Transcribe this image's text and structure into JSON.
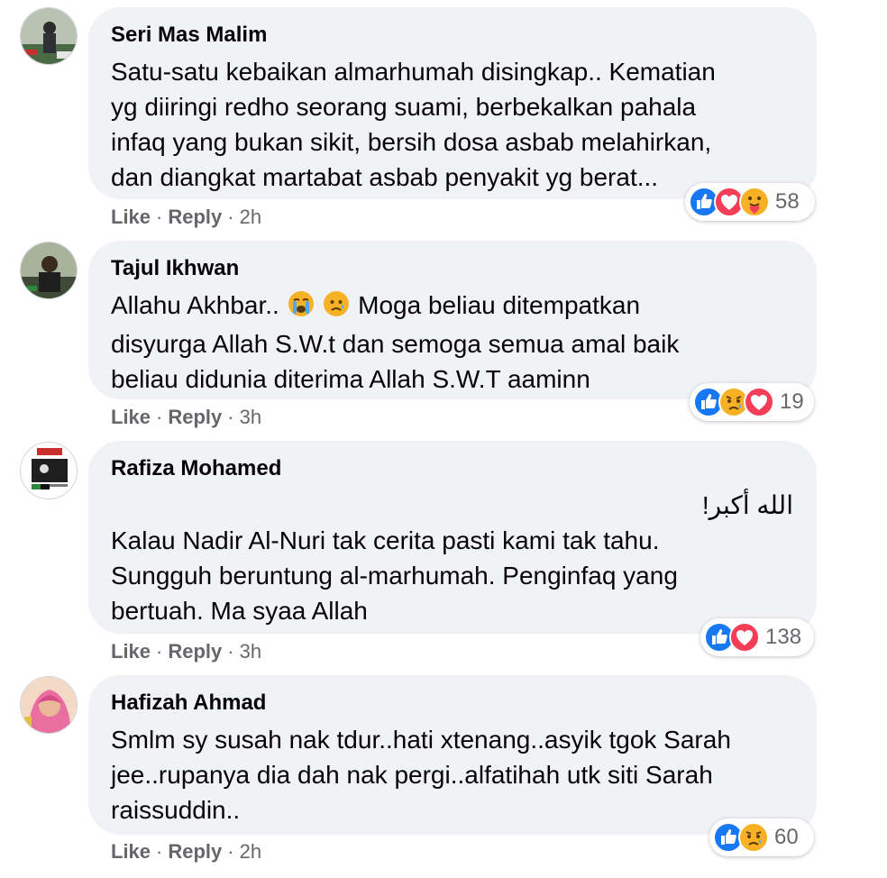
{
  "colors": {
    "bubble": "#f0f2f5",
    "meta": "#65676b",
    "like": "#1877f2",
    "love": "#f33e58",
    "emoji": "#f7b125"
  },
  "comments": [
    {
      "author": "Seri Mas Malim",
      "lines": [
        "Satu-satu kebaikan almarhumah disingkap.. Kematian",
        "yg diiringi redho seorang suami, berbekalkan pahala",
        "infaq yang bukan sikit, bersih dosa asbab melahirkan,",
        "dan diangkat martabat asbab penyakit yg berat..."
      ],
      "like": "Like",
      "reply": "Reply",
      "time": "2h",
      "reactions": [
        "like-icon",
        "love-icon",
        "care-icon"
      ],
      "reaction_count": "58"
    },
    {
      "author": "Tajul Ikhwan",
      "line1_pre": "Allahu Akhbar..",
      "line1_post": "Moga beliau ditempatkan",
      "inline_emojis": [
        "loudly-crying-face-icon",
        "sad-relieved-face-icon"
      ],
      "lines": [
        "disyurga Allah S.W.t dan semoga semua amal baik",
        "beliau didunia diterima Allah S.W.T aaminn"
      ],
      "like": "Like",
      "reply": "Reply",
      "time": "3h",
      "reactions": [
        "like-icon",
        "sad-icon",
        "love-icon"
      ],
      "reaction_count": "19"
    },
    {
      "author": "Rafiza Mohamed",
      "arabic": "الله أكبر!",
      "lines": [
        "Kalau Nadir Al-Nuri tak cerita pasti kami tak tahu.",
        "Sungguh beruntung al-marhumah. Penginfaq yang",
        "bertuah. Ma syaa Allah"
      ],
      "like": "Like",
      "reply": "Reply",
      "time": "3h",
      "reactions": [
        "like-icon",
        "love-icon"
      ],
      "reaction_count": "138"
    },
    {
      "author": "Hafizah Ahmad",
      "lines": [
        "Smlm sy susah nak tdur..hati xtenang..asyik tgok Sarah",
        "jee..rupanya dia dah nak pergi..alfatihah utk siti Sarah",
        "raissuddin.."
      ],
      "like": "Like",
      "reply": "Reply",
      "time": "2h",
      "reactions": [
        "like-icon",
        "sad-icon"
      ],
      "reaction_count": "60"
    }
  ]
}
